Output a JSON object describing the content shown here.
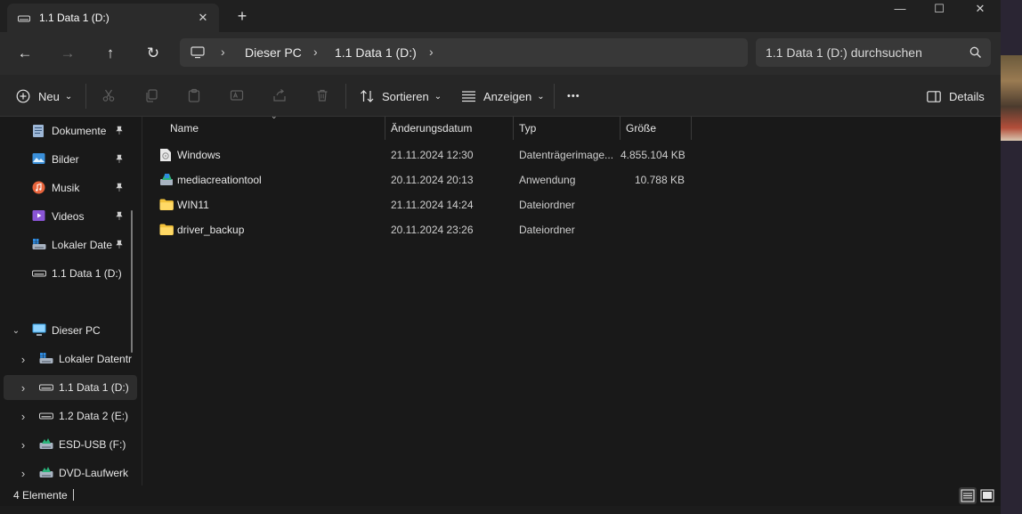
{
  "tab": {
    "title": "1.1 Data 1 (D:)",
    "close_glyph": "✕",
    "new_tab_glyph": "+"
  },
  "window_controls": {
    "minimize": "—",
    "maximize": "☐",
    "close": "✕"
  },
  "nav": {
    "back": "←",
    "forward": "→",
    "up": "↑",
    "refresh": "↻"
  },
  "address": {
    "crumbs": [
      "Dieser PC",
      "1.1 Data 1 (D:)"
    ],
    "separator": "›"
  },
  "search": {
    "placeholder": "1.1 Data 1 (D:) durchsuchen"
  },
  "commandbar": {
    "new_label": "Neu",
    "sort_label": "Sortieren",
    "view_label": "Anzeigen",
    "more_label": "•••",
    "details_label": "Details",
    "dropdown_glyph": "⌄"
  },
  "sidebar": {
    "quick_access": [
      {
        "label": "Dokumente",
        "icon": "documents-icon",
        "pinned": true
      },
      {
        "label": "Bilder",
        "icon": "pictures-icon",
        "pinned": true
      },
      {
        "label": "Musik",
        "icon": "music-icon",
        "pinned": true
      },
      {
        "label": "Videos",
        "icon": "videos-icon",
        "pinned": true
      },
      {
        "label": "Lokaler Datentr",
        "icon": "local-disk-icon",
        "pinned": true
      },
      {
        "label": "1.1 Data 1 (D:)",
        "icon": "drive-icon",
        "pinned": false
      }
    ],
    "this_pc": {
      "label": "Dieser PC",
      "icon": "computer-icon",
      "expanded": true
    },
    "drives": [
      {
        "label": "Lokaler Datentr",
        "icon": "local-disk-icon",
        "selected": false
      },
      {
        "label": "1.1 Data 1 (D:)",
        "icon": "drive-icon",
        "selected": true
      },
      {
        "label": "1.2 Data 2 (E:)",
        "icon": "drive-icon",
        "selected": false
      },
      {
        "label": "ESD-USB (F:)",
        "icon": "usb-drive-icon",
        "selected": false
      },
      {
        "label": "DVD-Laufwerk",
        "icon": "dvd-drive-icon",
        "selected": false
      }
    ],
    "pin_glyph": "📌",
    "expand_glyph": "›",
    "expanded_glyph": "⌄"
  },
  "columns": [
    "Name",
    "Änderungsdatum",
    "Typ",
    "Größe"
  ],
  "sort_indicator": "⌄",
  "files": [
    {
      "name": "Windows",
      "date": "21.11.2024 12:30",
      "type": "Datenträgerimage...",
      "size": "4.855.104 KB",
      "icon": "disc-image-icon"
    },
    {
      "name": "mediacreationtool",
      "date": "20.11.2024 20:13",
      "type": "Anwendung",
      "size": "10.788 KB",
      "icon": "installer-icon"
    },
    {
      "name": "WIN11",
      "date": "21.11.2024 14:24",
      "type": "Dateiordner",
      "size": "",
      "icon": "folder-icon"
    },
    {
      "name": "driver_backup",
      "date": "20.11.2024 23:26",
      "type": "Dateiordner",
      "size": "",
      "icon": "folder-icon"
    }
  ],
  "status": {
    "count": "4 Elemente"
  },
  "colors": {
    "accent": "#4cc2ff",
    "folder": "#f3c23b",
    "background": "#191919",
    "toolbar": "#262626"
  }
}
